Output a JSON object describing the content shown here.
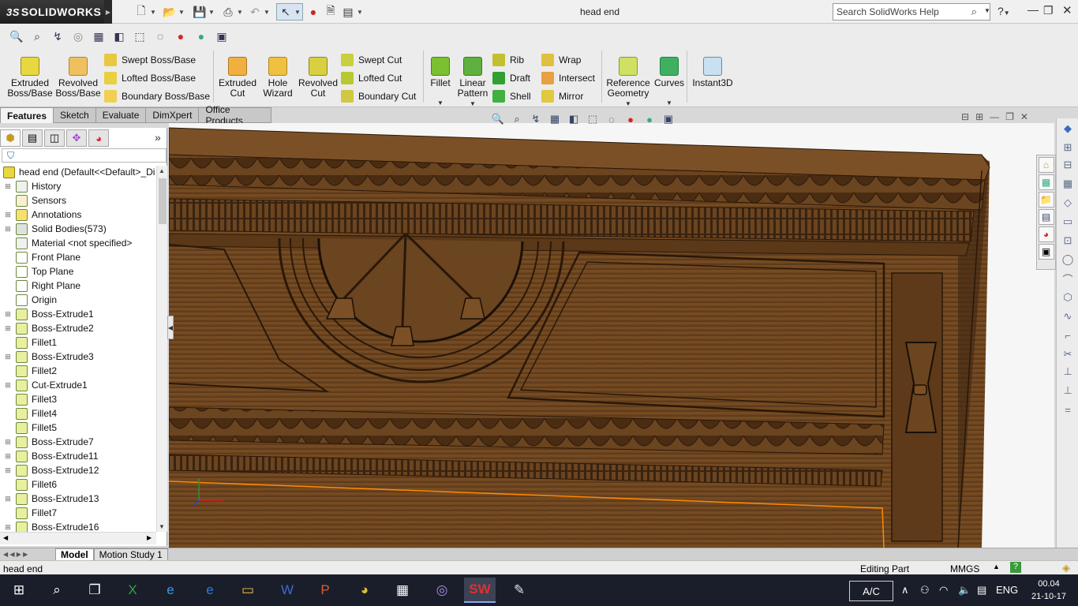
{
  "window": {
    "brand": "SOLIDWORKS",
    "brand_prefix": "3S",
    "document_title": "head end",
    "search_placeholder": "Search SolidWorks Help",
    "help_glyph": "?"
  },
  "features_toolbar": {
    "extruded_boss": "Extruded\nBoss/Base",
    "revolved_boss": "Revolved\nBoss/Base",
    "swept_boss": "Swept Boss/Base",
    "lofted_boss": "Lofted Boss/Base",
    "boundary_boss": "Boundary Boss/Base",
    "extruded_cut": "Extruded\nCut",
    "hole_wizard": "Hole\nWizard",
    "revolved_cut": "Revolved\nCut",
    "swept_cut": "Swept Cut",
    "lofted_cut": "Lofted Cut",
    "boundary_cut": "Boundary Cut",
    "fillet": "Fillet",
    "linear_pattern": "Linear\nPattern",
    "rib": "Rib",
    "draft": "Draft",
    "shell": "Shell",
    "wrap": "Wrap",
    "intersect": "Intersect",
    "mirror": "Mirror",
    "reference_geometry": "Reference\nGeometry",
    "curves": "Curves",
    "instant3d": "Instant3D"
  },
  "cm_tabs": [
    "Features",
    "Sketch",
    "Evaluate",
    "DimXpert",
    "Office Products"
  ],
  "feature_tree": {
    "root": "head end  (Default<<Default>_Di",
    "items": [
      {
        "label": "History",
        "expand": true,
        "color": "#f0f0f0"
      },
      {
        "label": "Sensors",
        "expand": false,
        "color": "#f8f0d0"
      },
      {
        "label": "Annotations",
        "expand": true,
        "color": "#f8e070"
      },
      {
        "label": "Solid Bodies(573)",
        "expand": true,
        "color": "#e0e0e0"
      },
      {
        "label": "Material <not specified>",
        "expand": false,
        "color": "#f0f0f0"
      },
      {
        "label": "Front Plane",
        "expand": false,
        "color": "#ffffff"
      },
      {
        "label": "Top Plane",
        "expand": false,
        "color": "#ffffff"
      },
      {
        "label": "Right Plane",
        "expand": false,
        "color": "#ffffff"
      },
      {
        "label": "Origin",
        "expand": false,
        "color": "#ffffff"
      },
      {
        "label": "Boss-Extrude1",
        "expand": true,
        "color": "#e8f0a0"
      },
      {
        "label": "Boss-Extrude2",
        "expand": true,
        "color": "#e8f0a0"
      },
      {
        "label": "Fillet1",
        "expand": false,
        "color": "#e8f0a0"
      },
      {
        "label": "Boss-Extrude3",
        "expand": true,
        "color": "#e8f0a0"
      },
      {
        "label": "Fillet2",
        "expand": false,
        "color": "#e8f0a0"
      },
      {
        "label": "Cut-Extrude1",
        "expand": true,
        "color": "#e8f0a0"
      },
      {
        "label": "Fillet3",
        "expand": false,
        "color": "#e8f0a0"
      },
      {
        "label": "Fillet4",
        "expand": false,
        "color": "#e8f0a0"
      },
      {
        "label": "Fillet5",
        "expand": false,
        "color": "#e8f0a0"
      },
      {
        "label": "Boss-Extrude7",
        "expand": true,
        "color": "#e8f0a0"
      },
      {
        "label": "Boss-Extrude11",
        "expand": true,
        "color": "#e8f0a0"
      },
      {
        "label": "Boss-Extrude12",
        "expand": true,
        "color": "#e8f0a0"
      },
      {
        "label": "Fillet6",
        "expand": false,
        "color": "#e8f0a0"
      },
      {
        "label": "Boss-Extrude13",
        "expand": true,
        "color": "#e8f0a0"
      },
      {
        "label": "Fillet7",
        "expand": false,
        "color": "#e8f0a0"
      },
      {
        "label": "Boss-Extrude16",
        "expand": true,
        "color": "#e8f0a0"
      }
    ]
  },
  "bottom_tabs": [
    "Model",
    "Motion Study 1"
  ],
  "status": {
    "left": "head end",
    "mode": "Editing Part",
    "units": "MMGS"
  },
  "taskbar": {
    "ac_label": "A/C",
    "language": "ENG",
    "time": "00.04",
    "date": "21-10-17"
  },
  "colors": {
    "wood_dark": "#3a2410",
    "wood_mid": "#6b4420",
    "wood_light": "#8a5a2a",
    "accent_orange": "#ff8a00"
  }
}
